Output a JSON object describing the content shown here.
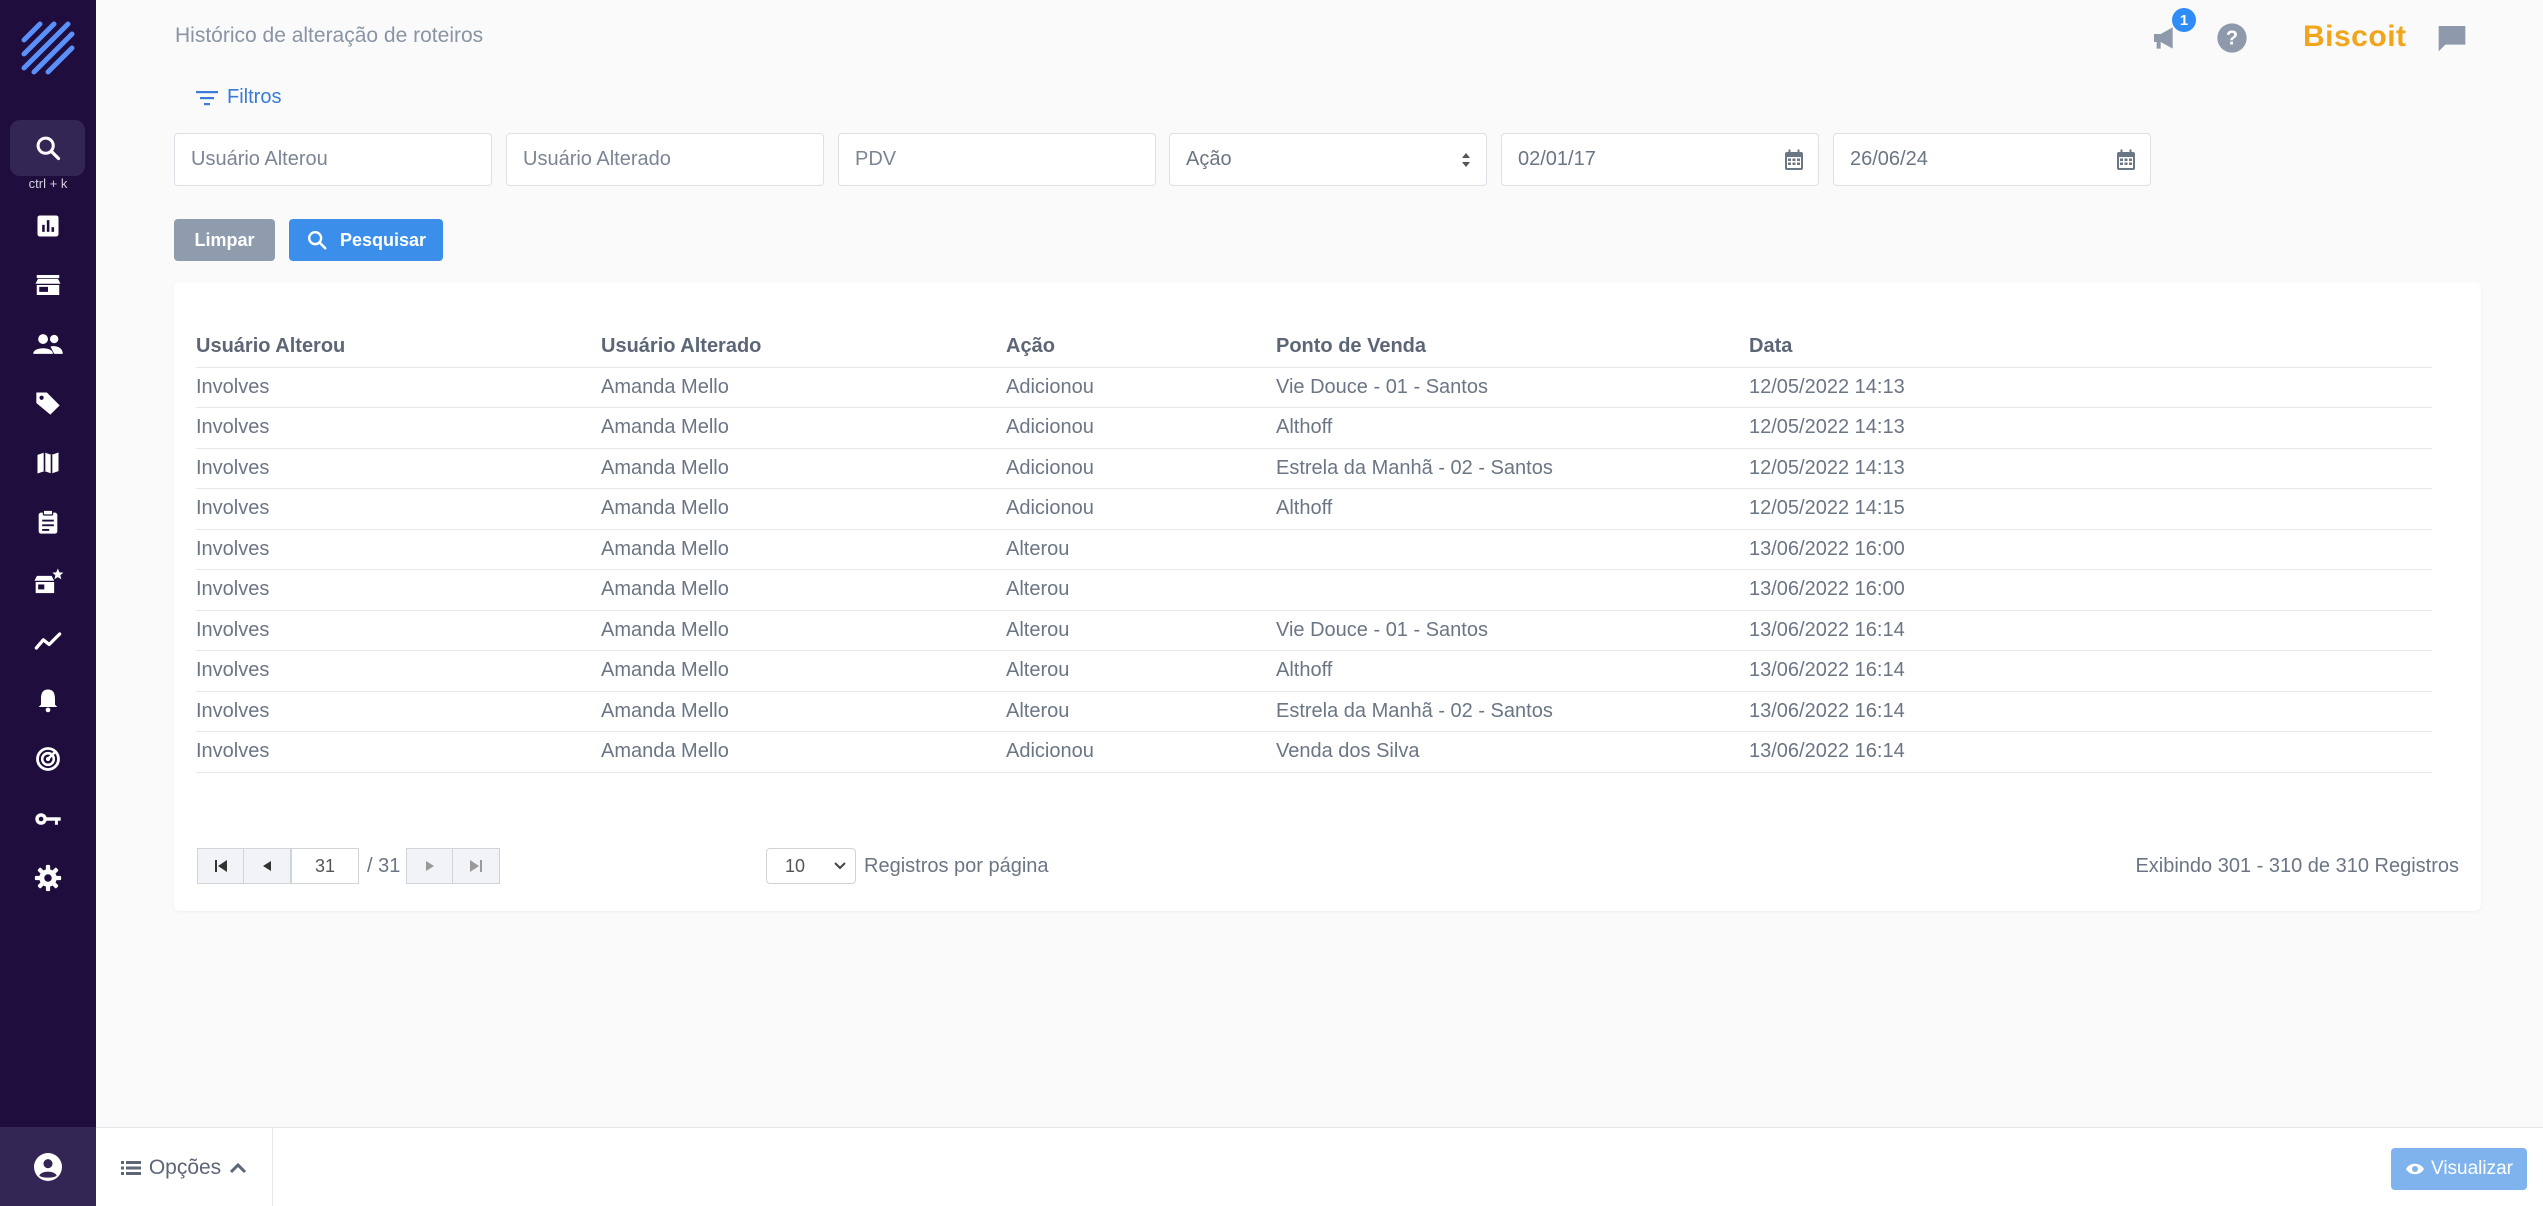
{
  "header": {
    "title": "Histórico de alteração de roteiros",
    "notification_count": "1",
    "brand": "Biscoit"
  },
  "sidebar": {
    "search_hint": "ctrl + k",
    "items": [
      {
        "icon": "bar-chart-icon"
      },
      {
        "icon": "store-icon"
      },
      {
        "icon": "users-icon"
      },
      {
        "icon": "tag-icon"
      },
      {
        "icon": "map-icon"
      },
      {
        "icon": "clipboard-icon"
      },
      {
        "icon": "store-star-icon"
      },
      {
        "icon": "trend-line-icon"
      },
      {
        "icon": "bell-icon"
      },
      {
        "icon": "radar-icon"
      },
      {
        "icon": "key-icon"
      },
      {
        "icon": "gear-icon"
      }
    ]
  },
  "filters": {
    "toggle_label": "Filtros",
    "usuario_alterou_placeholder": "Usuário Alterou",
    "usuario_alterado_placeholder": "Usuário Alterado",
    "pdv_placeholder": "PDV",
    "acao_value": "Ação",
    "date_from": "02/01/17",
    "date_to": "26/06/24",
    "clear_label": "Limpar",
    "search_label": "Pesquisar"
  },
  "table": {
    "headers": [
      "Usuário Alterou",
      "Usuário Alterado",
      "Ação",
      "Ponto de Venda",
      "Data"
    ],
    "rows": [
      [
        "Involves",
        "Amanda Mello",
        "Adicionou",
        "Vie Douce - 01 - Santos",
        "12/05/2022 14:13"
      ],
      [
        "Involves",
        "Amanda Mello",
        "Adicionou",
        "Althoff",
        "12/05/2022 14:13"
      ],
      [
        "Involves",
        "Amanda Mello",
        "Adicionou",
        "Estrela da Manhã - 02 - Santos",
        "12/05/2022 14:13"
      ],
      [
        "Involves",
        "Amanda Mello",
        "Adicionou",
        "Althoff",
        "12/05/2022 14:15"
      ],
      [
        "Involves",
        "Amanda Mello",
        "Alterou",
        "",
        "13/06/2022 16:00"
      ],
      [
        "Involves",
        "Amanda Mello",
        "Alterou",
        "",
        "13/06/2022 16:00"
      ],
      [
        "Involves",
        "Amanda Mello",
        "Alterou",
        "Vie Douce - 01 - Santos",
        "13/06/2022 16:14"
      ],
      [
        "Involves",
        "Amanda Mello",
        "Alterou",
        "Althoff",
        "13/06/2022 16:14"
      ],
      [
        "Involves",
        "Amanda Mello",
        "Alterou",
        "Estrela da Manhã - 02 - Santos",
        "13/06/2022 16:14"
      ],
      [
        "Involves",
        "Amanda Mello",
        "Adicionou",
        "Venda dos Silva",
        "13/06/2022 16:14"
      ]
    ]
  },
  "pagination": {
    "current_page": "31",
    "total_pages": "/ 31",
    "per_page": "10",
    "per_page_label": "Registros por página",
    "records_text": "Exibindo 301 - 310 de 310 Registros"
  },
  "footer": {
    "options_label": "Opções",
    "visualizar_label": "Visualizar"
  },
  "colors": {
    "sidebar_bg": "#1f0d3d",
    "accent": "#3b8fea",
    "brand": "#f2a51a"
  }
}
